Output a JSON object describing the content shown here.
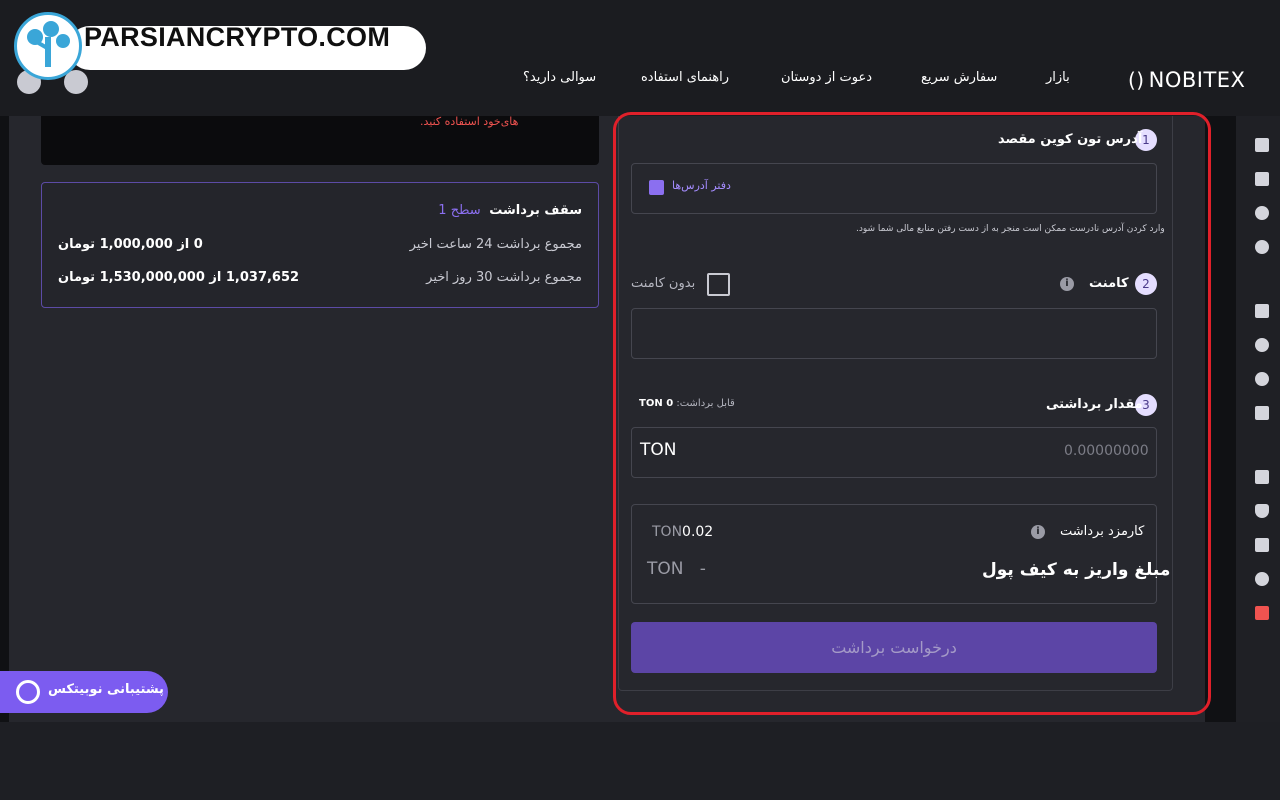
{
  "watermark": {
    "text": "PARSIANCRYPTO.COM"
  },
  "header": {
    "logo": "NOBITEX",
    "logo_mark": "()",
    "nav": [
      "بازار",
      "سفارش سریع",
      "دعوت از دوستان",
      "راهنمای استفاده",
      "سوالی دارید؟"
    ]
  },
  "notice": {
    "text": "های‌خود استفاده کنید."
  },
  "limits": {
    "title": "سقف برداشت",
    "level": "سطح 1",
    "rows": [
      {
        "label": "مجموع برداشت 24 ساعت اخیر",
        "value": "0 از 1,000,000 تومان"
      },
      {
        "label": "مجموع برداشت 30 روز اخیر",
        "value": "1,037,652 از 1,530,000,000 تومان"
      }
    ]
  },
  "form": {
    "step1": {
      "num": "1",
      "title": "آدرس تون کوین مقصد",
      "address_book": "دفتر آدرس‌ها",
      "hint": "وارد کردن آدرس نادرست ممکن است منجر به از دست رفتن منابع مالی شما شود."
    },
    "step2": {
      "num": "2",
      "title": "کامنت",
      "no_comment": "بدون کامنت"
    },
    "step3": {
      "num": "3",
      "title": "مقدار برداشتی",
      "available_label": "قابل برداشت:",
      "available_value": "0 TON",
      "unit": "TON",
      "placeholder": "0.00000000"
    },
    "fee": {
      "label": "کارمزد برداشت",
      "value": "0.02",
      "unit": "TON"
    },
    "net": {
      "label": "مبلغ واریز به کیف پول",
      "value": "-",
      "unit": "TON"
    },
    "submit_label": "درخواست برداشت"
  },
  "support": {
    "label": "پشتیبانی نوبیتکس"
  },
  "colors": {
    "accent": "#7c5cf0",
    "highlight_outline": "#e0202a",
    "warning": "#ef5350"
  }
}
